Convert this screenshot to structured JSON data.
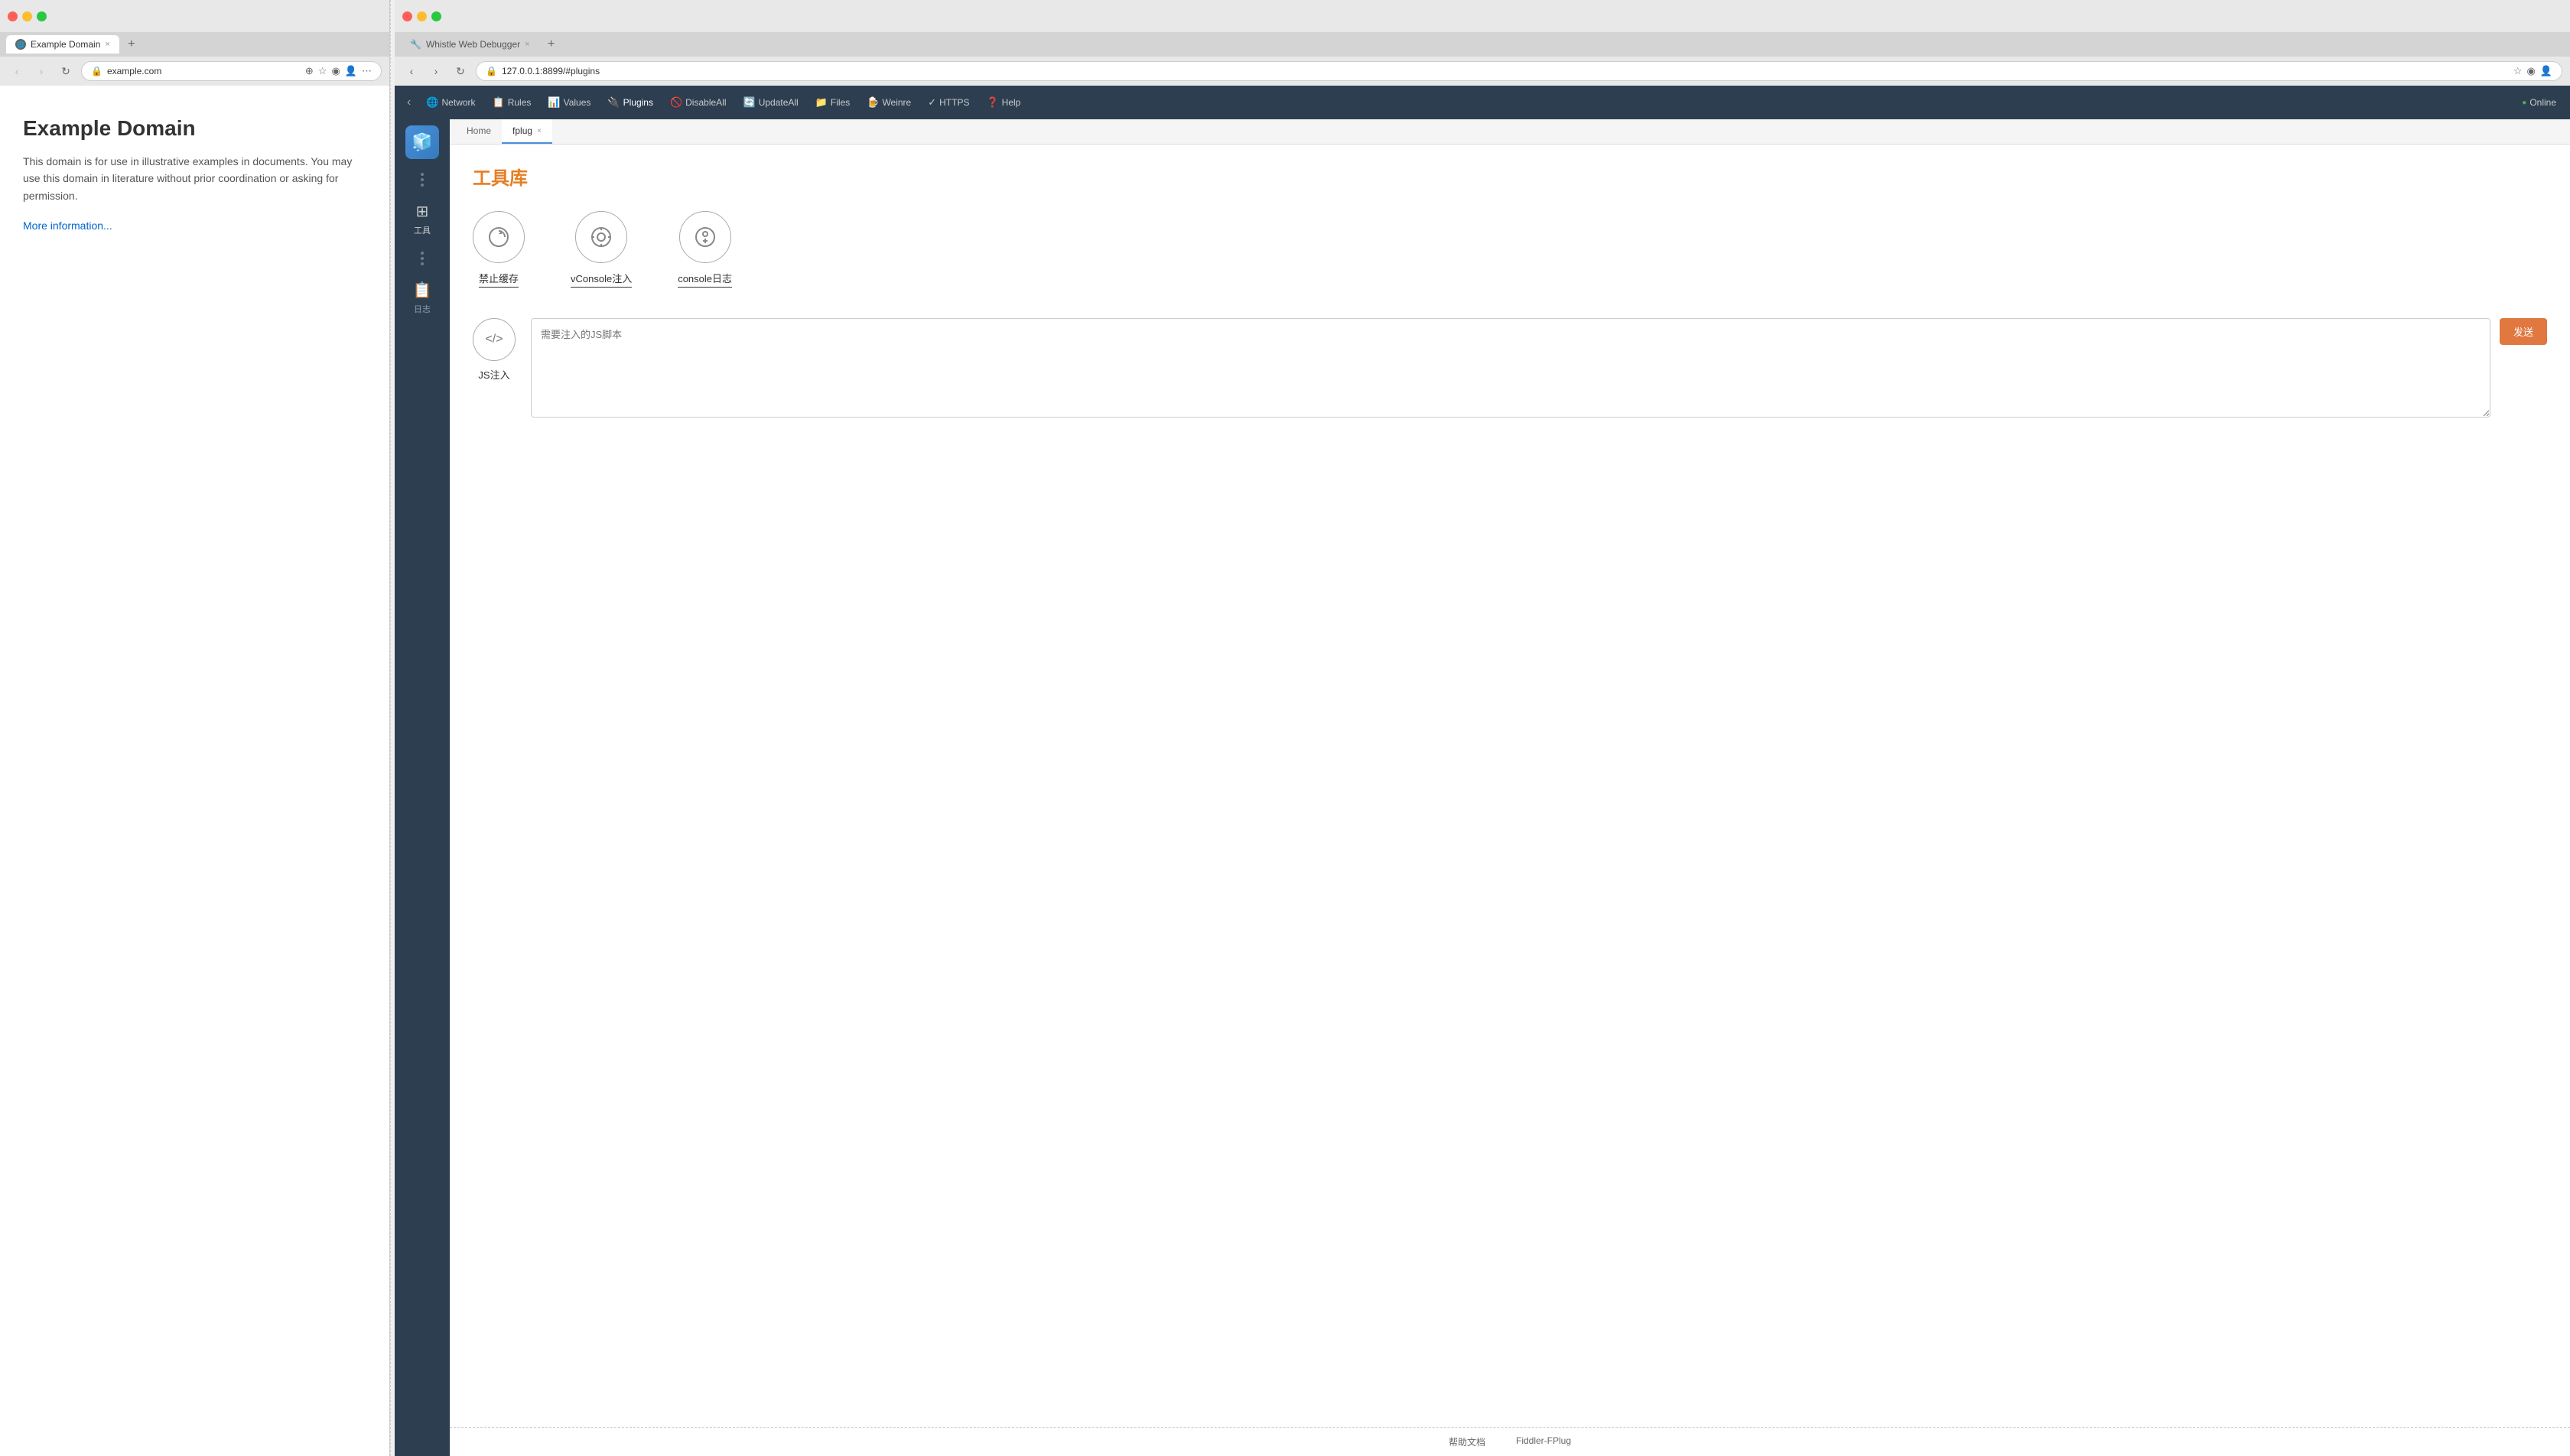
{
  "left_browser": {
    "traffic_lights": [
      "close",
      "minimize",
      "maximize"
    ],
    "tab": {
      "favicon": "🌐",
      "title": "Example Domain",
      "close": "×"
    },
    "new_tab": "+",
    "address_bar": {
      "url": "example.com",
      "lock_icon": "🔒"
    },
    "nav": {
      "back": "‹",
      "forward": "›",
      "refresh": "↻"
    },
    "page": {
      "title": "Example Domain",
      "description": "This domain is for use in illustrative examples in documents. You may use this domain in literature without prior coordination or asking for permission.",
      "link": "More information..."
    }
  },
  "right_browser": {
    "traffic_lights": [
      "close",
      "minimize",
      "maximize"
    ],
    "tab": {
      "favicon": "🔧",
      "title": "Whistle Web Debugger",
      "close": "×"
    },
    "new_tab": "+",
    "address_bar": {
      "url": "127.0.0.1:8899/#plugins",
      "lock_icon": "🔒"
    },
    "nav": {
      "back": "‹",
      "forward": "›",
      "refresh": "↻"
    }
  },
  "whistle": {
    "toolbar": {
      "back": "‹",
      "items": [
        {
          "icon": "🌐",
          "label": "Network"
        },
        {
          "icon": "📋",
          "label": "Rules"
        },
        {
          "icon": "📊",
          "label": "Values"
        },
        {
          "icon": "🔌",
          "label": "Plugins"
        },
        {
          "icon": "🚫",
          "label": "DisableAll"
        },
        {
          "icon": "🔄",
          "label": "UpdateAll"
        },
        {
          "icon": "📁",
          "label": "Files"
        },
        {
          "icon": "🍺",
          "label": "Weinre"
        },
        {
          "icon": "✓",
          "label": "HTTPS"
        },
        {
          "icon": "❓",
          "label": "Help"
        }
      ],
      "online_label": "● Online"
    },
    "sidebar": {
      "logo": "🧊",
      "items": [
        {
          "icon": "⋯",
          "label": ""
        },
        {
          "icon": "⊞",
          "label": "工具"
        },
        {
          "icon": "⋯",
          "label": ""
        },
        {
          "icon": "📋",
          "label": "日志"
        }
      ]
    },
    "tabs": [
      {
        "label": "Home",
        "active": false
      },
      {
        "label": "fplug",
        "active": true,
        "closable": true
      }
    ],
    "plugin": {
      "section_title": "工具库",
      "tools": [
        {
          "icon": "↺",
          "label": "禁止缓存"
        },
        {
          "icon": "⚙",
          "label": "vConsole注入"
        },
        {
          "icon": "🐛",
          "label": "console日志"
        }
      ],
      "js_inject": {
        "icon": "</>",
        "label": "JS注入",
        "textarea_placeholder": "需要注入的JS脚本",
        "send_button": "发送"
      }
    },
    "footer": {
      "links": [
        "帮助文档",
        "Fiddler-FPlug"
      ]
    }
  }
}
